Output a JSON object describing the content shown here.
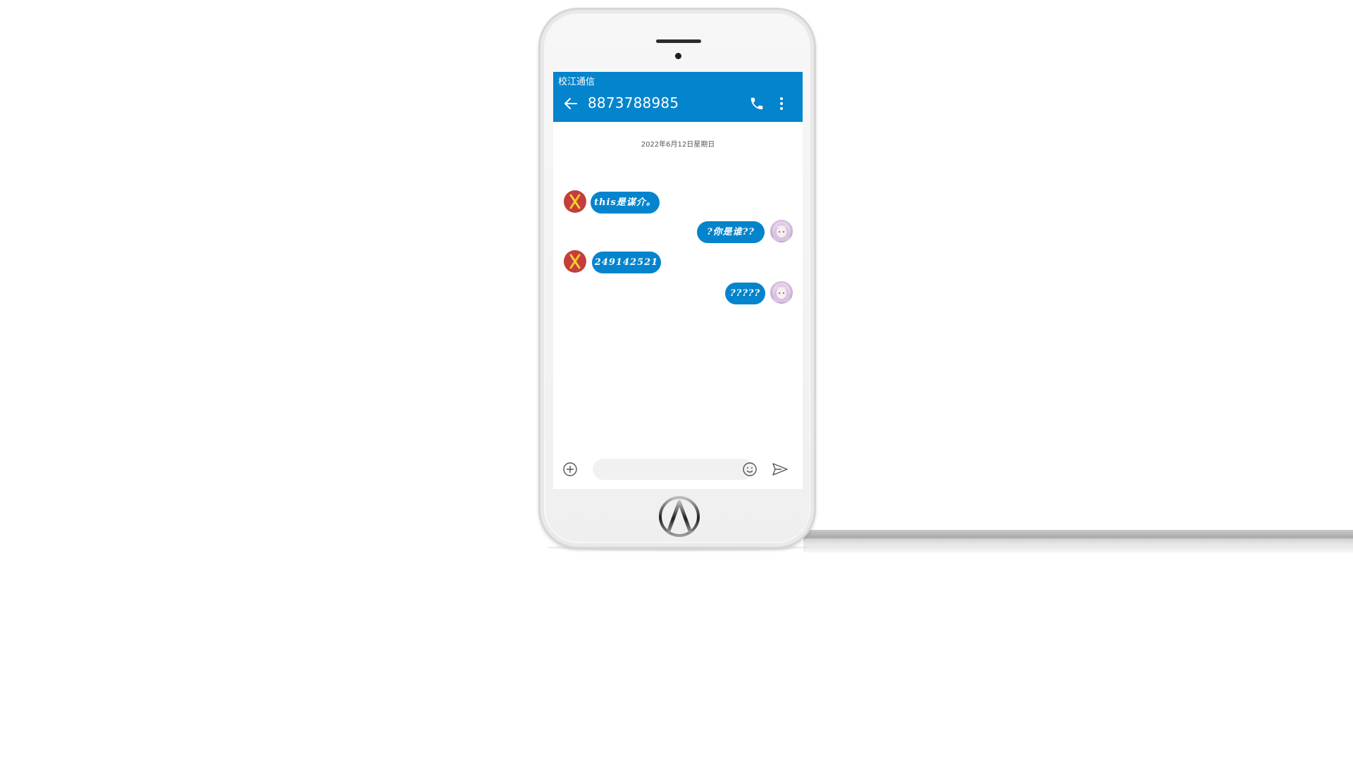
{
  "header": {
    "carrier": "校江通信",
    "contact_number": "8873788985"
  },
  "conversation": {
    "date": "2022年6月12日星期日",
    "messages": [
      {
        "side": "received",
        "text": "this是谋介。"
      },
      {
        "side": "sent",
        "text": "?你是谁??"
      },
      {
        "side": "received",
        "text": "249142521"
      },
      {
        "side": "sent",
        "text": "?????"
      }
    ]
  },
  "composer": {
    "placeholder": "",
    "value": ""
  },
  "colors": {
    "accent": "#0484cc",
    "avatar_red": "#c53d3d",
    "x_mark": "#f2c418"
  },
  "icons": [
    "back-arrow-icon",
    "phone-call-icon",
    "more-vert-icon",
    "add-circle-icon",
    "emoji-icon",
    "send-icon",
    "home-logo-icon"
  ]
}
